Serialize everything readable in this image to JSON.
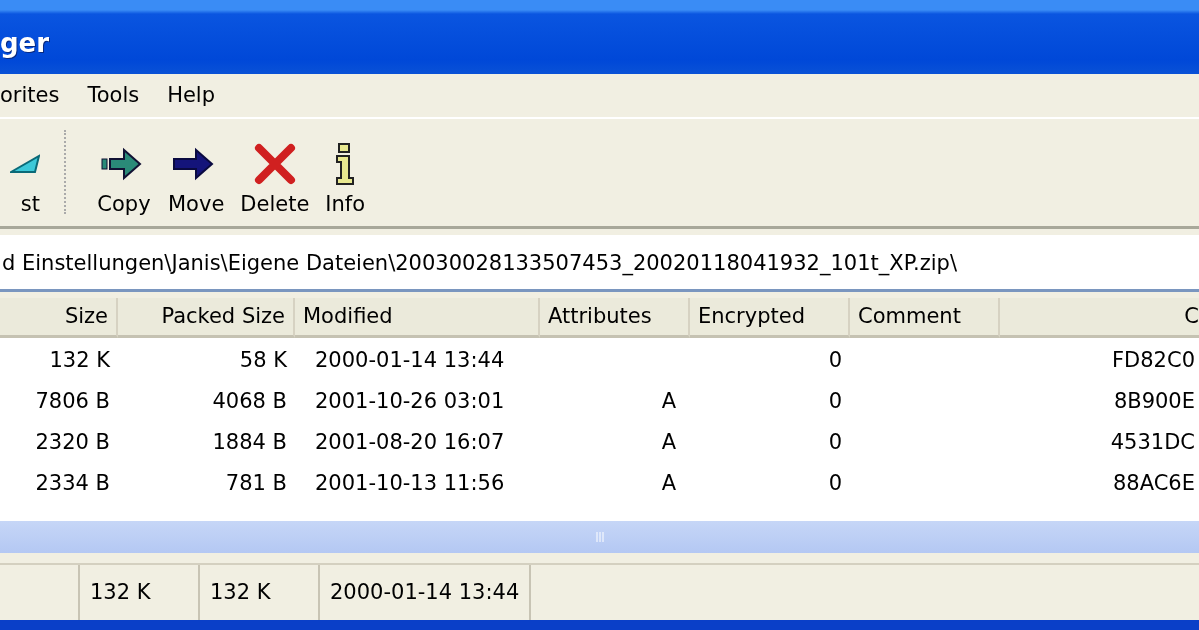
{
  "window": {
    "title": "ger"
  },
  "menu": [
    "orites",
    "Tools",
    "Help"
  ],
  "toolbar": [
    {
      "label": "st",
      "kind": "test"
    },
    {
      "label": "Copy",
      "kind": "copy"
    },
    {
      "label": "Move",
      "kind": "move"
    },
    {
      "label": "Delete",
      "kind": "delete"
    },
    {
      "label": "Info",
      "kind": "info"
    }
  ],
  "address": {
    "value": "d Einstellungen\\Janis\\Eigene Dateien\\20030028133507453_20020118041932_101t_XP.zip\\"
  },
  "table": {
    "columns": [
      "Size",
      "Packed Size",
      "Modified",
      "Attributes",
      "Encrypted",
      "Comment",
      "C"
    ],
    "rows": [
      {
        "size": "132 K",
        "packed": "58 K",
        "modified": "2000-01-14 13:44",
        "encrypted": "0",
        "crc": "FD82C0"
      },
      {
        "size": "7806 B",
        "packed": "4068 B",
        "modified": "2001-10-26 03:01",
        "attributes": "A",
        "encrypted": "0",
        "crc": "8B900E"
      },
      {
        "size": "2320 B",
        "packed": "1884 B",
        "modified": "2001-08-20 16:07",
        "attributes": "A",
        "encrypted": "0",
        "crc": "4531DC"
      },
      {
        "size": "2334 B",
        "packed": "781 B",
        "modified": "2001-10-13 11:56",
        "attributes": "A",
        "encrypted": "0",
        "crc": "88AC6E"
      }
    ]
  },
  "status_bar": [
    "132 K",
    "132 K",
    "2000-01-14 13:44"
  ]
}
